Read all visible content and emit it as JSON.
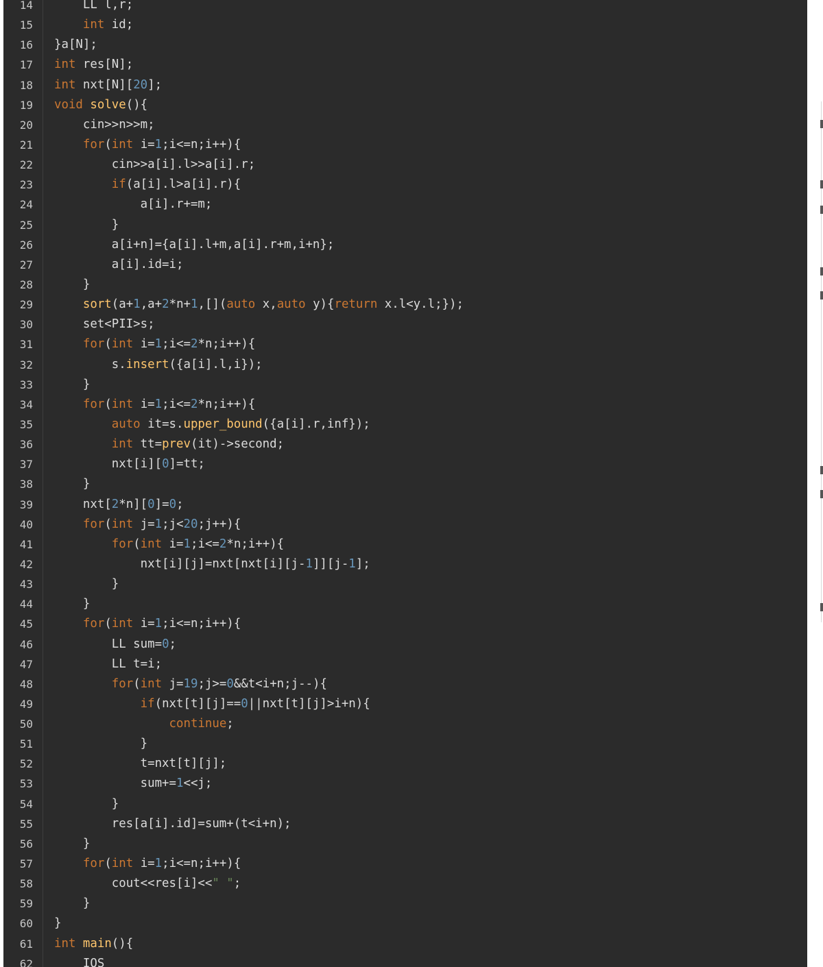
{
  "editor": {
    "colors": {
      "background": "#2b2b2b",
      "line_number": "#c7c7c7",
      "plain": "#dcdcdc",
      "keyword": "#cc7832",
      "function": "#ffc66d",
      "number": "#6897bb",
      "string": "#6a8759"
    },
    "lines": [
      {
        "no": "14",
        "tokens": [
          {
            "t": "    LL l,r;",
            "c": "plain"
          }
        ]
      },
      {
        "no": "15",
        "tokens": [
          {
            "t": "    ",
            "c": "plain"
          },
          {
            "t": "int",
            "c": "kw"
          },
          {
            "t": " id;",
            "c": "plain"
          }
        ]
      },
      {
        "no": "16",
        "tokens": [
          {
            "t": "}a[N];",
            "c": "plain"
          }
        ]
      },
      {
        "no": "17",
        "tokens": [
          {
            "t": "int",
            "c": "kw"
          },
          {
            "t": " res[N];",
            "c": "plain"
          }
        ]
      },
      {
        "no": "18",
        "tokens": [
          {
            "t": "int",
            "c": "kw"
          },
          {
            "t": " nxt[N][",
            "c": "plain"
          },
          {
            "t": "20",
            "c": "num"
          },
          {
            "t": "];",
            "c": "plain"
          }
        ]
      },
      {
        "no": "19",
        "tokens": [
          {
            "t": "void",
            "c": "kw"
          },
          {
            "t": " ",
            "c": "plain"
          },
          {
            "t": "solve",
            "c": "fn"
          },
          {
            "t": "(){",
            "c": "plain"
          }
        ]
      },
      {
        "no": "20",
        "tokens": [
          {
            "t": "    cin>>n>>m;",
            "c": "plain"
          }
        ]
      },
      {
        "no": "21",
        "tokens": [
          {
            "t": "    ",
            "c": "plain"
          },
          {
            "t": "for",
            "c": "kw"
          },
          {
            "t": "(",
            "c": "plain"
          },
          {
            "t": "int",
            "c": "kw"
          },
          {
            "t": " i=",
            "c": "plain"
          },
          {
            "t": "1",
            "c": "num"
          },
          {
            "t": ";i<=n;i++){",
            "c": "plain"
          }
        ]
      },
      {
        "no": "22",
        "tokens": [
          {
            "t": "        cin>>a[i].l>>a[i].r;",
            "c": "plain"
          }
        ]
      },
      {
        "no": "23",
        "tokens": [
          {
            "t": "        ",
            "c": "plain"
          },
          {
            "t": "if",
            "c": "kw"
          },
          {
            "t": "(a[i].l>a[i].r){",
            "c": "plain"
          }
        ]
      },
      {
        "no": "24",
        "tokens": [
          {
            "t": "            a[i].r+=m;",
            "c": "plain"
          }
        ]
      },
      {
        "no": "25",
        "tokens": [
          {
            "t": "        }",
            "c": "plain"
          }
        ]
      },
      {
        "no": "26",
        "tokens": [
          {
            "t": "        a[i+n]={a[i].l+m,a[i].r+m,i+n};",
            "c": "plain"
          }
        ]
      },
      {
        "no": "27",
        "tokens": [
          {
            "t": "        a[i].id=i;",
            "c": "plain"
          }
        ]
      },
      {
        "no": "28",
        "tokens": [
          {
            "t": "    }",
            "c": "plain"
          }
        ]
      },
      {
        "no": "29",
        "tokens": [
          {
            "t": "    ",
            "c": "plain"
          },
          {
            "t": "sort",
            "c": "fn"
          },
          {
            "t": "(a+",
            "c": "plain"
          },
          {
            "t": "1",
            "c": "num"
          },
          {
            "t": ",a+",
            "c": "plain"
          },
          {
            "t": "2",
            "c": "num"
          },
          {
            "t": "*n+",
            "c": "plain"
          },
          {
            "t": "1",
            "c": "num"
          },
          {
            "t": ",[](",
            "c": "plain"
          },
          {
            "t": "auto",
            "c": "kw"
          },
          {
            "t": " x,",
            "c": "plain"
          },
          {
            "t": "auto",
            "c": "kw"
          },
          {
            "t": " y){",
            "c": "plain"
          },
          {
            "t": "return",
            "c": "kw"
          },
          {
            "t": " x.l<y.l;});",
            "c": "plain"
          }
        ]
      },
      {
        "no": "30",
        "tokens": [
          {
            "t": "    set<PII>s;",
            "c": "plain"
          }
        ]
      },
      {
        "no": "31",
        "tokens": [
          {
            "t": "    ",
            "c": "plain"
          },
          {
            "t": "for",
            "c": "kw"
          },
          {
            "t": "(",
            "c": "plain"
          },
          {
            "t": "int",
            "c": "kw"
          },
          {
            "t": " i=",
            "c": "plain"
          },
          {
            "t": "1",
            "c": "num"
          },
          {
            "t": ";i<=",
            "c": "plain"
          },
          {
            "t": "2",
            "c": "num"
          },
          {
            "t": "*n;i++){",
            "c": "plain"
          }
        ]
      },
      {
        "no": "32",
        "tokens": [
          {
            "t": "        s.",
            "c": "plain"
          },
          {
            "t": "insert",
            "c": "fn"
          },
          {
            "t": "({a[i].l,i});",
            "c": "plain"
          }
        ]
      },
      {
        "no": "33",
        "tokens": [
          {
            "t": "    }",
            "c": "plain"
          }
        ]
      },
      {
        "no": "34",
        "tokens": [
          {
            "t": "    ",
            "c": "plain"
          },
          {
            "t": "for",
            "c": "kw"
          },
          {
            "t": "(",
            "c": "plain"
          },
          {
            "t": "int",
            "c": "kw"
          },
          {
            "t": " i=",
            "c": "plain"
          },
          {
            "t": "1",
            "c": "num"
          },
          {
            "t": ";i<=",
            "c": "plain"
          },
          {
            "t": "2",
            "c": "num"
          },
          {
            "t": "*n;i++){",
            "c": "plain"
          }
        ]
      },
      {
        "no": "35",
        "tokens": [
          {
            "t": "        ",
            "c": "plain"
          },
          {
            "t": "auto",
            "c": "kw"
          },
          {
            "t": " it=s.",
            "c": "plain"
          },
          {
            "t": "upper_bound",
            "c": "fn"
          },
          {
            "t": "({a[i].r,inf});",
            "c": "plain"
          }
        ]
      },
      {
        "no": "36",
        "tokens": [
          {
            "t": "        ",
            "c": "plain"
          },
          {
            "t": "int",
            "c": "kw"
          },
          {
            "t": " tt=",
            "c": "plain"
          },
          {
            "t": "prev",
            "c": "fn"
          },
          {
            "t": "(it)->second;",
            "c": "plain"
          }
        ]
      },
      {
        "no": "37",
        "tokens": [
          {
            "t": "        nxt[i][",
            "c": "plain"
          },
          {
            "t": "0",
            "c": "num"
          },
          {
            "t": "]=tt;",
            "c": "plain"
          }
        ]
      },
      {
        "no": "38",
        "tokens": [
          {
            "t": "    }",
            "c": "plain"
          }
        ]
      },
      {
        "no": "39",
        "tokens": [
          {
            "t": "    nxt[",
            "c": "plain"
          },
          {
            "t": "2",
            "c": "num"
          },
          {
            "t": "*n][",
            "c": "plain"
          },
          {
            "t": "0",
            "c": "num"
          },
          {
            "t": "]=",
            "c": "plain"
          },
          {
            "t": "0",
            "c": "num"
          },
          {
            "t": ";",
            "c": "plain"
          }
        ]
      },
      {
        "no": "40",
        "tokens": [
          {
            "t": "    ",
            "c": "plain"
          },
          {
            "t": "for",
            "c": "kw"
          },
          {
            "t": "(",
            "c": "plain"
          },
          {
            "t": "int",
            "c": "kw"
          },
          {
            "t": " j=",
            "c": "plain"
          },
          {
            "t": "1",
            "c": "num"
          },
          {
            "t": ";j<",
            "c": "plain"
          },
          {
            "t": "20",
            "c": "num"
          },
          {
            "t": ";j++){",
            "c": "plain"
          }
        ]
      },
      {
        "no": "41",
        "tokens": [
          {
            "t": "        ",
            "c": "plain"
          },
          {
            "t": "for",
            "c": "kw"
          },
          {
            "t": "(",
            "c": "plain"
          },
          {
            "t": "int",
            "c": "kw"
          },
          {
            "t": " i=",
            "c": "plain"
          },
          {
            "t": "1",
            "c": "num"
          },
          {
            "t": ";i<=",
            "c": "plain"
          },
          {
            "t": "2",
            "c": "num"
          },
          {
            "t": "*n;i++){",
            "c": "plain"
          }
        ]
      },
      {
        "no": "42",
        "tokens": [
          {
            "t": "            nxt[i][j]=nxt[nxt[i][j-",
            "c": "plain"
          },
          {
            "t": "1",
            "c": "num"
          },
          {
            "t": "]][j-",
            "c": "plain"
          },
          {
            "t": "1",
            "c": "num"
          },
          {
            "t": "];",
            "c": "plain"
          }
        ]
      },
      {
        "no": "43",
        "tokens": [
          {
            "t": "        }",
            "c": "plain"
          }
        ]
      },
      {
        "no": "44",
        "tokens": [
          {
            "t": "    }",
            "c": "plain"
          }
        ]
      },
      {
        "no": "45",
        "tokens": [
          {
            "t": "    ",
            "c": "plain"
          },
          {
            "t": "for",
            "c": "kw"
          },
          {
            "t": "(",
            "c": "plain"
          },
          {
            "t": "int",
            "c": "kw"
          },
          {
            "t": " i=",
            "c": "plain"
          },
          {
            "t": "1",
            "c": "num"
          },
          {
            "t": ";i<=n;i++){",
            "c": "plain"
          }
        ]
      },
      {
        "no": "46",
        "tokens": [
          {
            "t": "        LL sum=",
            "c": "plain"
          },
          {
            "t": "0",
            "c": "num"
          },
          {
            "t": ";",
            "c": "plain"
          }
        ]
      },
      {
        "no": "47",
        "tokens": [
          {
            "t": "        LL t=i;",
            "c": "plain"
          }
        ]
      },
      {
        "no": "48",
        "tokens": [
          {
            "t": "        ",
            "c": "plain"
          },
          {
            "t": "for",
            "c": "kw"
          },
          {
            "t": "(",
            "c": "plain"
          },
          {
            "t": "int",
            "c": "kw"
          },
          {
            "t": " j=",
            "c": "plain"
          },
          {
            "t": "19",
            "c": "num"
          },
          {
            "t": ";j>=",
            "c": "plain"
          },
          {
            "t": "0",
            "c": "num"
          },
          {
            "t": "&&t<i+n;j--){",
            "c": "plain"
          }
        ]
      },
      {
        "no": "49",
        "tokens": [
          {
            "t": "            ",
            "c": "plain"
          },
          {
            "t": "if",
            "c": "kw"
          },
          {
            "t": "(nxt[t][j]==",
            "c": "plain"
          },
          {
            "t": "0",
            "c": "num"
          },
          {
            "t": "||nxt[t][j]>i+n){",
            "c": "plain"
          }
        ]
      },
      {
        "no": "50",
        "tokens": [
          {
            "t": "                ",
            "c": "plain"
          },
          {
            "t": "continue",
            "c": "kw"
          },
          {
            "t": ";",
            "c": "plain"
          }
        ]
      },
      {
        "no": "51",
        "tokens": [
          {
            "t": "            }",
            "c": "plain"
          }
        ]
      },
      {
        "no": "52",
        "tokens": [
          {
            "t": "            t=nxt[t][j];",
            "c": "plain"
          }
        ]
      },
      {
        "no": "53",
        "tokens": [
          {
            "t": "            sum+=",
            "c": "plain"
          },
          {
            "t": "1",
            "c": "num"
          },
          {
            "t": "<<j;",
            "c": "plain"
          }
        ]
      },
      {
        "no": "54",
        "tokens": [
          {
            "t": "        }",
            "c": "plain"
          }
        ]
      },
      {
        "no": "55",
        "tokens": [
          {
            "t": "        res[a[i].id]=sum+(t<i+n);",
            "c": "plain"
          }
        ]
      },
      {
        "no": "56",
        "tokens": [
          {
            "t": "    }",
            "c": "plain"
          }
        ]
      },
      {
        "no": "57",
        "tokens": [
          {
            "t": "    ",
            "c": "plain"
          },
          {
            "t": "for",
            "c": "kw"
          },
          {
            "t": "(",
            "c": "plain"
          },
          {
            "t": "int",
            "c": "kw"
          },
          {
            "t": " i=",
            "c": "plain"
          },
          {
            "t": "1",
            "c": "num"
          },
          {
            "t": ";i<=n;i++){",
            "c": "plain"
          }
        ]
      },
      {
        "no": "58",
        "tokens": [
          {
            "t": "        cout<<res[i]<<",
            "c": "plain"
          },
          {
            "t": "\" \"",
            "c": "str"
          },
          {
            "t": ";",
            "c": "plain"
          }
        ]
      },
      {
        "no": "59",
        "tokens": [
          {
            "t": "    }",
            "c": "plain"
          }
        ]
      },
      {
        "no": "60",
        "tokens": [
          {
            "t": "}",
            "c": "plain"
          }
        ]
      },
      {
        "no": "61",
        "tokens": [
          {
            "t": "int",
            "c": "kw"
          },
          {
            "t": " ",
            "c": "plain"
          },
          {
            "t": "main",
            "c": "fn"
          },
          {
            "t": "(){",
            "c": "plain"
          }
        ]
      },
      {
        "no": "62",
        "tokens": [
          {
            "t": "    IOS",
            "c": "plain"
          }
        ]
      }
    ]
  }
}
